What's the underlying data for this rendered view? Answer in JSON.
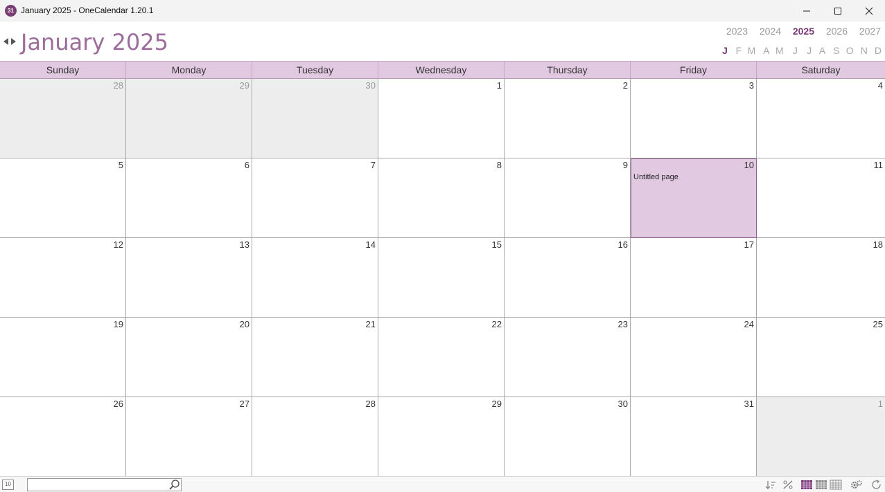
{
  "window": {
    "title": "January 2025 - OneCalendar 1.20.1",
    "icon_text": "31"
  },
  "header": {
    "month_title": "January 2025",
    "years": [
      "2023",
      "2024",
      "2025",
      "2026",
      "2027"
    ],
    "active_year_index": 2,
    "months": [
      "J",
      "F",
      "M",
      "A",
      "M",
      "J",
      "J",
      "A",
      "S",
      "O",
      "N",
      "D"
    ],
    "active_month_index": 0
  },
  "weekdays": [
    "Sunday",
    "Monday",
    "Tuesday",
    "Wednesday",
    "Thursday",
    "Friday",
    "Saturday"
  ],
  "weeks": [
    [
      {
        "d": "28",
        "other": true
      },
      {
        "d": "29",
        "other": true
      },
      {
        "d": "30",
        "other": true
      },
      {
        "d": "1"
      },
      {
        "d": "2"
      },
      {
        "d": "3"
      },
      {
        "d": "4"
      }
    ],
    [
      {
        "d": "5"
      },
      {
        "d": "6"
      },
      {
        "d": "7"
      },
      {
        "d": "8"
      },
      {
        "d": "9"
      },
      {
        "d": "10",
        "today": true,
        "event": "Untitled page"
      },
      {
        "d": "11"
      }
    ],
    [
      {
        "d": "12"
      },
      {
        "d": "13"
      },
      {
        "d": "14"
      },
      {
        "d": "15"
      },
      {
        "d": "16"
      },
      {
        "d": "17"
      },
      {
        "d": "18"
      }
    ],
    [
      {
        "d": "19"
      },
      {
        "d": "20"
      },
      {
        "d": "21"
      },
      {
        "d": "22"
      },
      {
        "d": "23"
      },
      {
        "d": "24"
      },
      {
        "d": "25"
      }
    ],
    [
      {
        "d": "26"
      },
      {
        "d": "27"
      },
      {
        "d": "28"
      },
      {
        "d": "29"
      },
      {
        "d": "30"
      },
      {
        "d": "31"
      },
      {
        "d": "1",
        "other": true
      }
    ]
  ],
  "statusbar": {
    "calendar_icon_text": "10",
    "search_placeholder": ""
  },
  "colors": {
    "accent": "#7b3a78",
    "title_color": "#9c6c9a",
    "header_bg": "#e2c9e2",
    "today_bg": "#e2c9e2",
    "other_month_bg": "#ededed"
  }
}
